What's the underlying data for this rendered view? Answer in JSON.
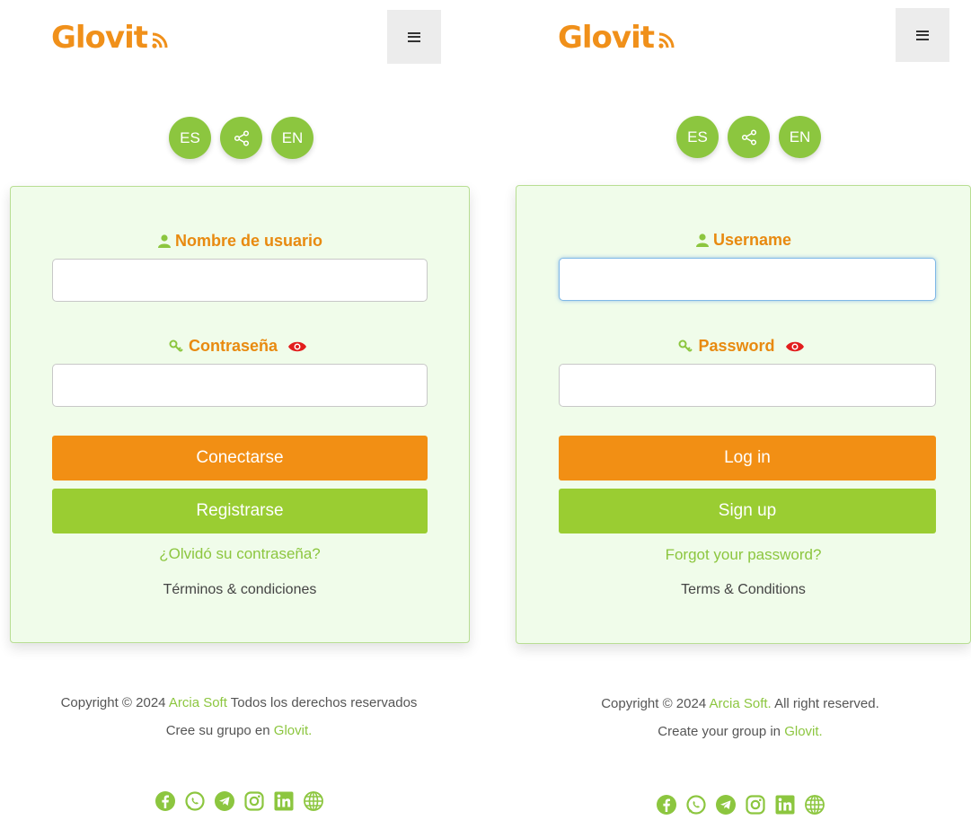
{
  "colors": {
    "orange": "#f28f14",
    "green": "#8cc63f",
    "card_bg": "#f0fcea"
  },
  "panels": {
    "es": {
      "brand": "Glovit",
      "lang_es": "ES",
      "lang_en": "EN",
      "username_label": "Nombre de usuario",
      "password_label": "Contraseña",
      "login_button": "Conectarse",
      "signup_button": "Registrarse",
      "forgot_link": "¿Olvidó su contraseña?",
      "terms_link": "Términos & condiciones",
      "copyright_prefix": "Copyright © 2024",
      "company": "Arcia Soft",
      "rights": "Todos los derechos reservados",
      "create_text": "Cree su grupo en",
      "create_link": "Glovit."
    },
    "en": {
      "brand": "Glovit",
      "lang_es": "ES",
      "lang_en": "EN",
      "username_label": "Username",
      "password_label": "Password",
      "login_button": "Log in",
      "signup_button": "Sign up",
      "forgot_link": "Forgot your password?",
      "terms_link": "Terms & Conditions",
      "copyright_prefix": "Copyright © 2024",
      "company": "Arcia Soft.",
      "rights": "All right reserved.",
      "create_text": "Create your group in",
      "create_link": "Glovit."
    }
  },
  "icons": [
    "menu-icon",
    "share-icon",
    "user-icon",
    "key-icon",
    "eye-icon",
    "rss-icon",
    "facebook-icon",
    "whatsapp-icon",
    "telegram-icon",
    "instagram-icon",
    "linkedin-icon",
    "globe-icon"
  ]
}
